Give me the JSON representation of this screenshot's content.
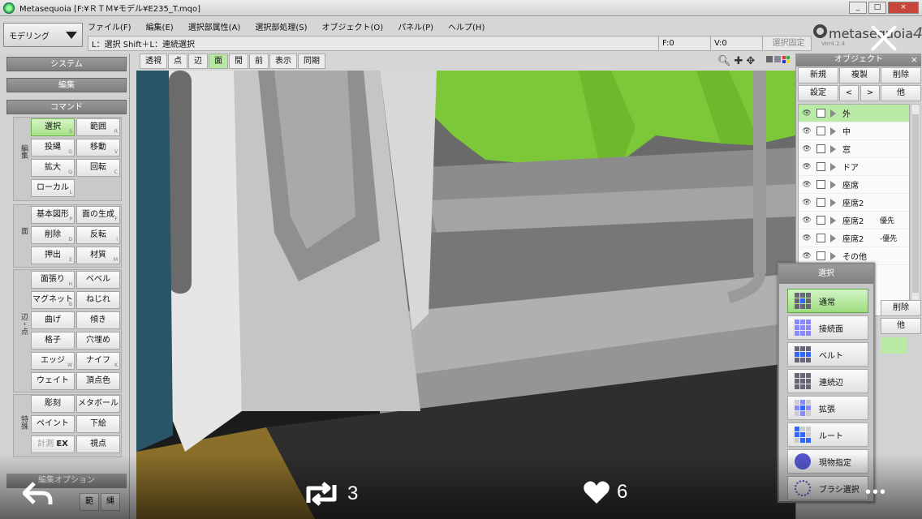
{
  "window": {
    "title": "Metasequoia [F:¥ＲＴＭ¥モデル¥E235_T.mqo]",
    "min": "_",
    "max": "□",
    "close": "×"
  },
  "mode": {
    "value": "モデリング"
  },
  "menu": [
    "ファイル(F)",
    "編集(E)",
    "選択部属性(A)",
    "選択部処理(S)",
    "オブジェクト(O)",
    "パネル(P)",
    "ヘルプ(H)"
  ],
  "status": {
    "message": "L：選択 Shift＋L：連続選択",
    "f": "F:0",
    "v": "V:0",
    "fixed": "選択固定"
  },
  "logo": {
    "text": "metasequoia",
    "num": "4",
    "ver": "Ver4.2.4"
  },
  "left_panel": {
    "system": "システム",
    "edit": "編集",
    "command": "コマンド",
    "groups": {
      "g1": "編集",
      "g2": "面",
      "g3": "辺・点",
      "g4": "特殊"
    },
    "buttons": {
      "select": "選択",
      "select_k": "S",
      "range": "範囲",
      "range_k": "R",
      "lasso": "投縄",
      "lasso_k": "G",
      "move": "移動",
      "move_k": "V",
      "scale": "拡大",
      "scale_k": "Q",
      "rotate": "回転",
      "rotate_k": "C",
      "local": "ローカル",
      "local_k": "L",
      "basic": "基本図形",
      "basic_k": "P",
      "facegen": "面の生成",
      "facegen_k": "F",
      "delete": "削除",
      "delete_k": "D",
      "flip": "反転",
      "flip_k": "I",
      "push": "押出",
      "push_k": "E",
      "material": "材質",
      "material_k": "M",
      "facestretch": "面張り",
      "facestretch_k": "H",
      "bevel": "ベベル",
      "magnet": "マグネット",
      "magnet_k": "B",
      "twist": "ねじれ",
      "bend": "曲げ",
      "tilt": "傾き",
      "lattice": "格子",
      "fillhole": "穴埋め",
      "edge": "エッジ",
      "edge_k": "W",
      "knife": "ナイフ",
      "knife_k": "K",
      "weight": "ウェイト",
      "vcolor": "頂点色",
      "sculpt": "彫刻",
      "metaball": "メタボール",
      "paint": "ペイント",
      "underlay": "下絵",
      "measure": "計測",
      "ex": "EX",
      "viewpoint": "視点"
    },
    "edit_options": "編集オプション",
    "opt_a": "範",
    "opt_b": "縄"
  },
  "toolbar": [
    "透視",
    "点",
    "辺",
    "面",
    "閒",
    "前",
    "表示",
    "同期"
  ],
  "object_panel": {
    "title": "オブジェクト",
    "close": "×",
    "new": "新規",
    "dup": "複製",
    "del": "削除",
    "settings": "設定",
    "prev": "<",
    "next": ">",
    "other": "他",
    "rows": [
      {
        "name": "外",
        "priority": ""
      },
      {
        "name": "中",
        "priority": ""
      },
      {
        "name": "窓",
        "priority": ""
      },
      {
        "name": "ドア",
        "priority": ""
      },
      {
        "name": "座席",
        "priority": ""
      },
      {
        "name": "座席2",
        "priority": ""
      },
      {
        "name": "座席2",
        "priority": "優先"
      },
      {
        "name": "座席2",
        "priority": "-優先"
      },
      {
        "name": "その他",
        "priority": ""
      }
    ],
    "eye": "👁",
    "lower_del": "削除",
    "lower_other": "他"
  },
  "select_popup": {
    "title": "選択",
    "options": [
      "通常",
      "接続面",
      "ベルト",
      "連続辺",
      "拡張",
      "ルート",
      "現物指定",
      "ブラシ選択"
    ]
  },
  "overlay": {
    "retweets": "3",
    "likes": "6",
    "more": "•••"
  },
  "colors": {
    "accent_green": "#7dc838",
    "select_green": "#b9eaa6"
  }
}
